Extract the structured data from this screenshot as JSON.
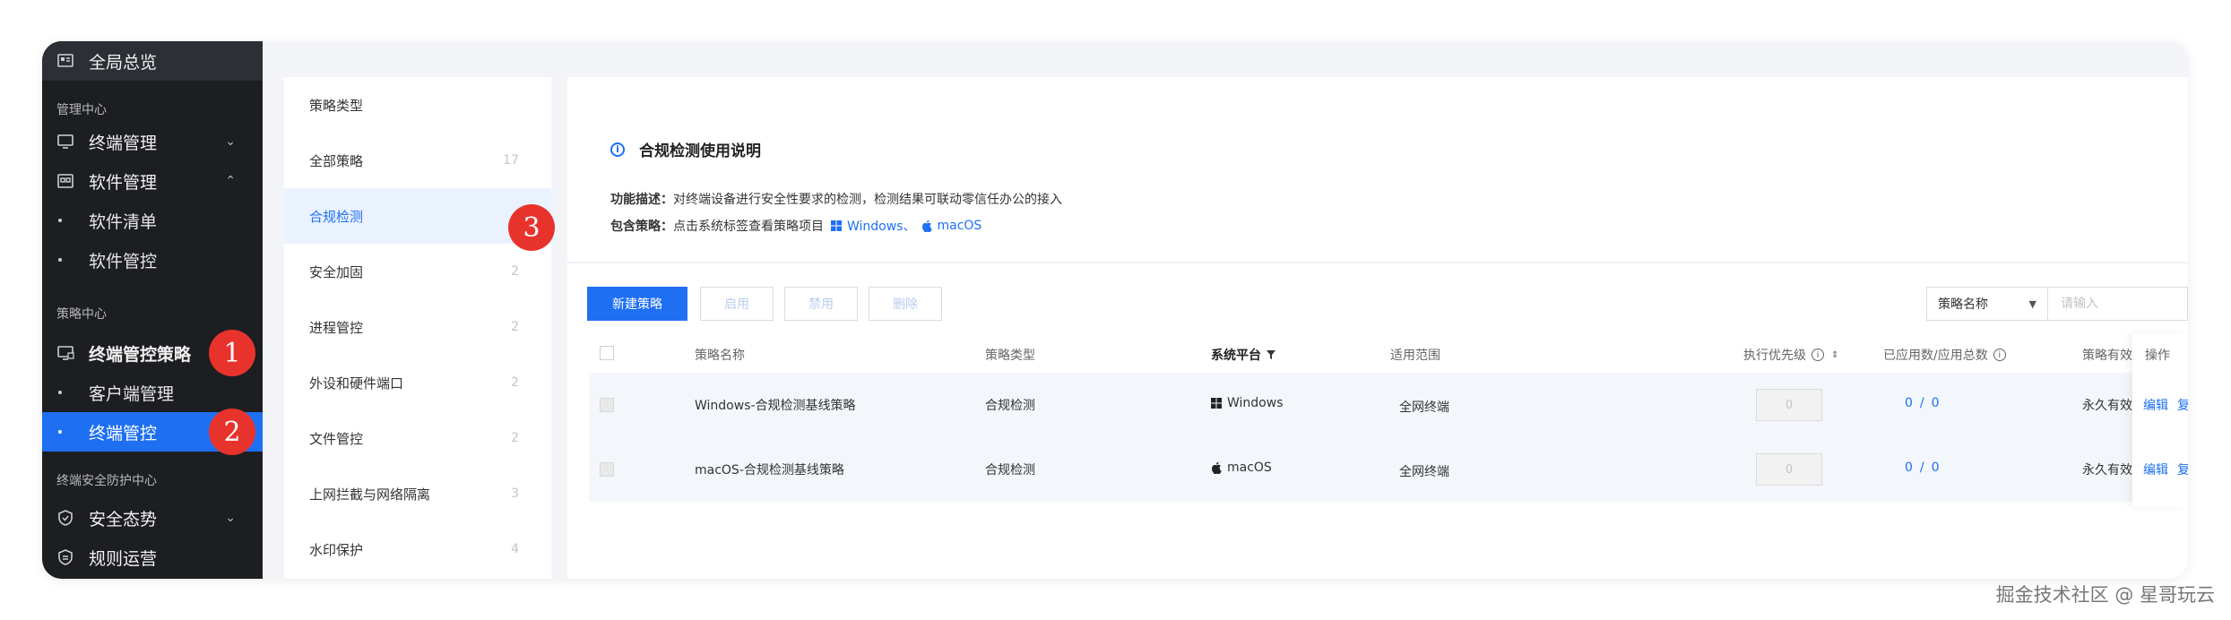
{
  "sidebar": {
    "top_item": "全局总览",
    "section_manage": "管理中心",
    "terminal_mgmt": "终端管理",
    "software_mgmt": "软件管理",
    "software_list": "软件清单",
    "software_control": "软件管控",
    "section_policy": "策略中心",
    "terminal_policy": "终端管控策略",
    "client_mgmt": "客户端管理",
    "terminal_control": "终端管控",
    "section_security": "终端安全防护中心",
    "security_posture": "安全态势",
    "rule_ops": "规则运营"
  },
  "badges": [
    "1",
    "2",
    "3"
  ],
  "categories": {
    "header": "策略类型",
    "items": [
      {
        "label": "全部策略",
        "count": "17"
      },
      {
        "label": "合规检测",
        "count": ""
      },
      {
        "label": "安全加固",
        "count": "2"
      },
      {
        "label": "进程管控",
        "count": "2"
      },
      {
        "label": "外设和硬件端口",
        "count": "2"
      },
      {
        "label": "文件管控",
        "count": "2"
      },
      {
        "label": "上网拦截与网络隔离",
        "count": "3"
      },
      {
        "label": "水印保护",
        "count": "4"
      }
    ]
  },
  "info": {
    "title": "合规检测使用说明",
    "desc_label": "功能描述：",
    "desc_text": "对终端设备进行安全性要求的检测，检测结果可联动零信任办公的接入",
    "policy_label": "包含策略：",
    "policy_text": "点击系统标签查看策略项目",
    "link_windows": "Windows、",
    "link_macos": "macOS"
  },
  "toolbar": {
    "new_policy": "新建策略",
    "enable": "启用",
    "disable": "禁用",
    "delete": "删除",
    "search_field": "策略名称",
    "search_placeholder": "请输入"
  },
  "table": {
    "headers": {
      "name": "策略名称",
      "type": "策略类型",
      "platform": "系统平台",
      "scope": "适用范围",
      "priority": "执行优先级",
      "applied": "已应用数/应用总数",
      "validity": "策略有效",
      "ops": "操作"
    },
    "rows": [
      {
        "name": "Windows-合规检测基线策略",
        "type": "合规检测",
        "platform": "Windows",
        "scope": "全网终端",
        "priority": "0",
        "applied": "0",
        "total": "0",
        "validity": "永久有效",
        "edit": "编辑",
        "copy": "复制"
      },
      {
        "name": "macOS-合规检测基线策略",
        "type": "合规检测",
        "platform": "macOS",
        "scope": "全网终端",
        "priority": "0",
        "applied": "0",
        "total": "0",
        "validity": "永久有效",
        "edit": "编辑",
        "copy": "复制"
      }
    ]
  },
  "watermark": "掘金技术社区 @ 星哥玩云",
  "colors": {
    "accent": "#1e6ff2",
    "sidebar_bg": "#1c1e22",
    "badge": "#e8332d"
  }
}
